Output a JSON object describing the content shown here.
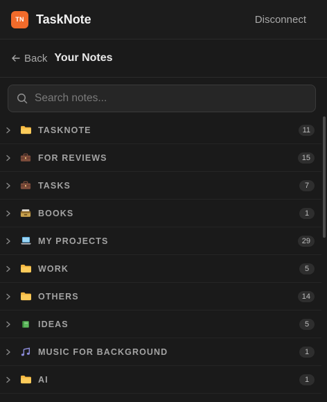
{
  "app": {
    "logo_text": "TN",
    "name": "TaskNote",
    "disconnect_label": "Disconnect"
  },
  "subheader": {
    "back_label": "Back",
    "title": "Your Notes"
  },
  "search": {
    "placeholder": "Search notes..."
  },
  "folders": [
    {
      "label": "TASKNOTE",
      "count": "11",
      "icon": "folder-icon"
    },
    {
      "label": "FOR REVIEWS",
      "count": "15",
      "icon": "briefcase-icon"
    },
    {
      "label": "TASKS",
      "count": "7",
      "icon": "briefcase-icon"
    },
    {
      "label": "BOOKS",
      "count": "1",
      "icon": "card-box-icon"
    },
    {
      "label": "MY PROJECTS",
      "count": "29",
      "icon": "laptop-icon"
    },
    {
      "label": "WORK",
      "count": "5",
      "icon": "folder-icon"
    },
    {
      "label": "OTHERS",
      "count": "14",
      "icon": "folder-icon"
    },
    {
      "label": "IDEAS",
      "count": "5",
      "icon": "green-book-icon"
    },
    {
      "label": "MUSIC FOR BACKGROUND",
      "count": "1",
      "icon": "music-note-icon"
    },
    {
      "label": "AI",
      "count": "1",
      "icon": "folder-icon"
    }
  ],
  "colors": {
    "background": "#1a1a1a",
    "logo": "#f26b2b",
    "folder": "#f5b841"
  }
}
